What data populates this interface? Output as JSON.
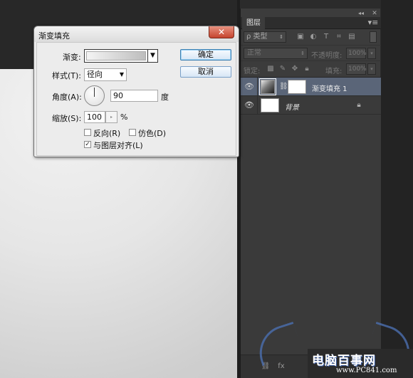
{
  "layers_panel": {
    "tab_label": "图层",
    "collapse_glyph": "◂◂",
    "close_glyph": "✕",
    "menu_glyph": "▾≡",
    "filter_kind": "ρ 类型",
    "blend_mode": "正常",
    "opacity_label": "不透明度:",
    "opacity_value": "100%",
    "lock_label": "锁定:",
    "fill_label": "填充:",
    "fill_value": "100%",
    "layers": [
      {
        "name": "渐变填充 1",
        "selected": true
      },
      {
        "name": "背景",
        "locked": true
      }
    ]
  },
  "dialog": {
    "title": "渐变填充",
    "close_glyph": "✕",
    "gradient_label": "渐变:",
    "style_label": "样式(T):",
    "style_value": "径向",
    "angle_label": "角度(A):",
    "angle_value": "90",
    "angle_unit": "度",
    "scale_label": "缩放(S):",
    "scale_value": "100",
    "scale_unit": "%",
    "reverse_label": "反向(R)",
    "reverse_checked": false,
    "dither_label": "仿色(D)",
    "dither_checked": false,
    "align_label": "与图层对齐(L)",
    "align_checked": true,
    "ok_label": "确定",
    "cancel_label": "取消"
  },
  "watermark": {
    "title": "电脑百事网",
    "url": "www.PC841.com"
  },
  "colors": {
    "panel_bg": "#3c3c3c",
    "selected_layer": "#5a6578",
    "dialog_bg": "#ececec",
    "close_button": "#c5442e"
  }
}
